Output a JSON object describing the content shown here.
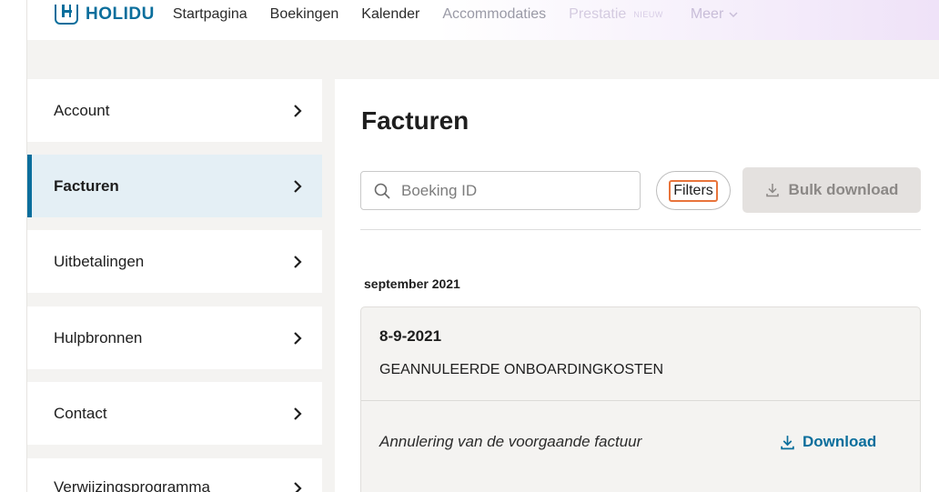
{
  "brand": {
    "name": "HOLIDU",
    "color": "#0a6e9c"
  },
  "nav": {
    "items": [
      {
        "label": "Startpagina"
      },
      {
        "label": "Boekingen"
      },
      {
        "label": "Kalender"
      },
      {
        "label": "Accommodaties"
      },
      {
        "label": "Prestatie"
      }
    ],
    "badge": "NIEUW",
    "more": "Meer"
  },
  "sidebar": {
    "items": [
      {
        "label": "Account",
        "active": false
      },
      {
        "label": "Facturen",
        "active": true
      },
      {
        "label": "Uitbetalingen",
        "active": false
      },
      {
        "label": "Hulpbronnen",
        "active": false
      },
      {
        "label": "Contact",
        "active": false
      },
      {
        "label": "Verwijzingsprogramma",
        "active": false
      }
    ]
  },
  "main": {
    "title": "Facturen",
    "search": {
      "placeholder": "Boeking ID",
      "value": ""
    },
    "filters_label": "Filters",
    "bulk_download_label": "Bulk download",
    "month": "september 2021",
    "invoice": {
      "date": "8-9-2021",
      "type": "GEANNULEERDE ONBOARDINGKOSTEN",
      "description": "Annulering van de voorgaande factuur",
      "download_label": "Download"
    }
  },
  "colors": {
    "accent": "#0a6e9c",
    "filters_outline": "#e8743b",
    "active_sidebar_bg": "#e4eff5"
  },
  "icons": {
    "search": "search-icon",
    "download": "download-icon",
    "chevron": "chevron-right-icon"
  }
}
